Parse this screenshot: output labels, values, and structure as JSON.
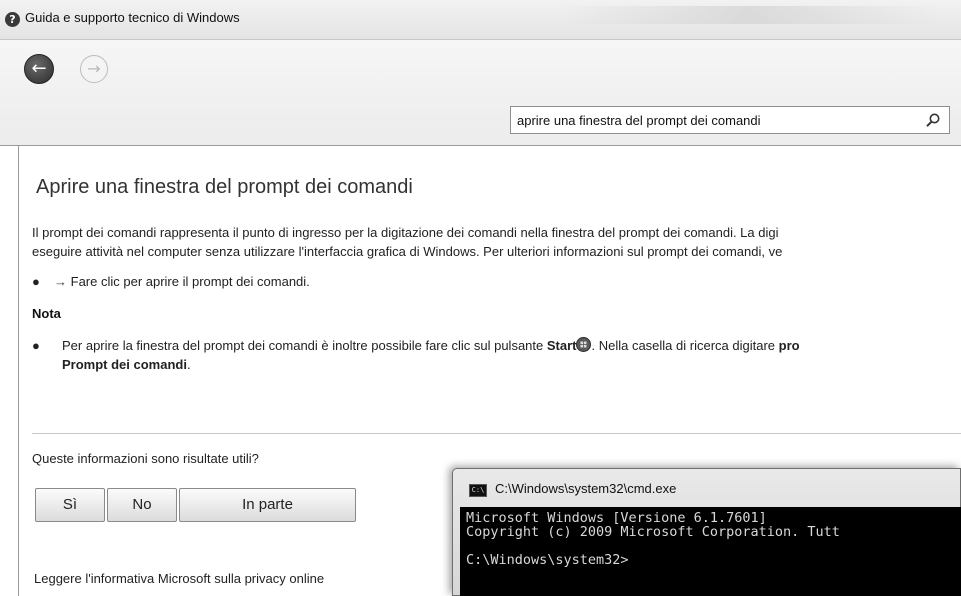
{
  "window": {
    "title": "Guida e supporto tecnico di Windows",
    "help_icon_glyph": "?"
  },
  "toolbar": {
    "back_glyph": "←",
    "forward_glyph": "→",
    "search_value": "aprire una finestra del prompt dei comandi"
  },
  "article": {
    "title": "Aprire una finestra del prompt dei comandi",
    "para_line1": "Il prompt dei comandi rappresenta il punto di ingresso per la digitazione dei comandi nella finestra del prompt dei comandi. La digi",
    "para_line2": "eseguire attività nel computer senza utilizzare l'interfaccia grafica di Windows. Per ulteriori informazioni sul prompt dei comandi, ve",
    "link_arrow": "→",
    "link_text": "Fare clic per aprire il prompt dei comandi.",
    "note_heading": "Nota",
    "note_text_1": "Per aprire la finestra del prompt dei comandi è inoltre possibile fare clic sul pulsante ",
    "note_start": "Start",
    "note_text_2": ". Nella casella di ricerca digitare ",
    "note_pro": "pro",
    "note_line2_bold": "Prompt dei comandi",
    "note_line2_end": "."
  },
  "feedback": {
    "question": "Queste informazioni sono risultate utili?",
    "yes": "Sì",
    "no": "No",
    "partial": "In parte",
    "privacy_link": "Leggere l'informativa Microsoft sulla privacy online"
  },
  "cmd": {
    "title": "C:\\Windows\\system32\\cmd.exe",
    "icon_text": "C:\\",
    "line1": "Microsoft Windows [Versione 6.1.7601]",
    "line2": "Copyright (c) 2009 Microsoft Corporation. Tutt",
    "line3": "",
    "line4": "C:\\Windows\\system32>"
  },
  "colors": {
    "console_bg": "#000000",
    "console_fg": "#d8d8d8",
    "chrome_bg": "#ececec"
  }
}
